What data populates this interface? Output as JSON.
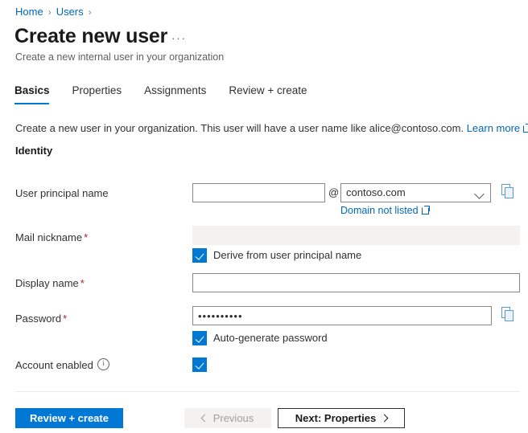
{
  "breadcrumb": {
    "items": [
      {
        "label": "Home"
      },
      {
        "label": "Users"
      }
    ],
    "separator": "›"
  },
  "header": {
    "title": "Create new user",
    "subtitle": "Create a new internal user in your organization",
    "more_menu": "···"
  },
  "tabs": [
    {
      "label": "Basics",
      "active": true
    },
    {
      "label": "Properties",
      "active": false
    },
    {
      "label": "Assignments",
      "active": false
    },
    {
      "label": "Review + create",
      "active": false
    }
  ],
  "intro": {
    "text": "Create a new user in your organization. This user will have a user name like alice@contoso.com.",
    "link_label": "Learn more",
    "link_icon": "external-link-icon"
  },
  "section": {
    "heading": "Identity"
  },
  "fields": {
    "upn": {
      "label": "User principal name",
      "value": "",
      "at": "@",
      "domain_selected": "contoso.com",
      "domain_chevron": "chevron-down-icon",
      "copy_icon": "copy-icon",
      "sub_link": "Domain not listed",
      "sub_link_icon": "external-link-icon"
    },
    "mail_nickname": {
      "label": "Mail nickname",
      "required": "*",
      "value": "",
      "disabled": true,
      "checkbox_label": "Derive from user principal name",
      "checkbox_checked": true
    },
    "display_name": {
      "label": "Display name",
      "required": "*",
      "value": ""
    },
    "password": {
      "label": "Password",
      "required": "*",
      "value": "••••••••••",
      "copy_icon": "copy-icon",
      "checkbox_label": "Auto-generate password",
      "checkbox_checked": true
    },
    "account_enabled": {
      "label": "Account enabled",
      "info_icon": "info-icon",
      "checked": true
    }
  },
  "footer": {
    "review_create": "Review + create",
    "previous": "Previous",
    "next": "Next: Properties",
    "previous_disabled": true
  },
  "colors": {
    "accent": "#0078d4",
    "link": "#0067b8",
    "required": "#a4262c",
    "disabled_bg": "#f3f2f1"
  }
}
